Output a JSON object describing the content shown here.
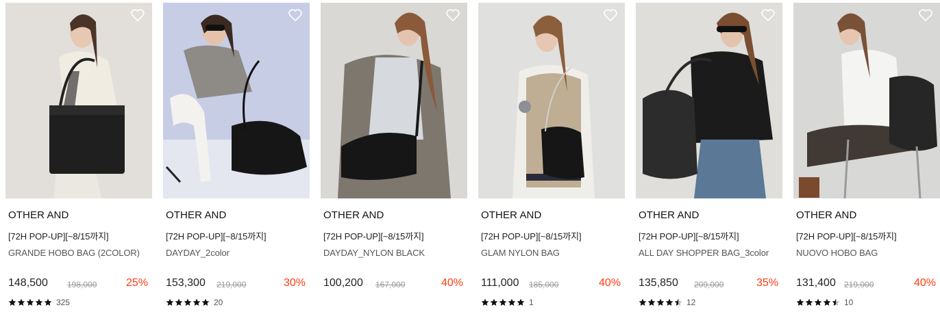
{
  "colors": {
    "discount": "#ff3a12",
    "original_price": "#999999",
    "star": "#111111"
  },
  "icons": {
    "wishlist": "heart-outline-icon",
    "rating": "star-icon"
  },
  "products": [
    {
      "brand": "OTHER AND",
      "promo": "[72H POP-UP][~8/15까지]",
      "name": "GRANDE HOBO BAG (2COLOR)",
      "price": "148,500",
      "original_price": "198,000",
      "discount": "25%",
      "stars": 5,
      "review_count": "325"
    },
    {
      "brand": "OTHER AND",
      "promo": "[72H POP-UP][~8/15까지]",
      "name": "DAYDAY_2color",
      "price": "153,300",
      "original_price": "219,000",
      "discount": "30%",
      "stars": 5,
      "review_count": "20"
    },
    {
      "brand": "OTHER AND",
      "promo": "[72H POP-UP][~8/15까지]",
      "name": "DAYDAY_NYLON BLACK",
      "price": "100,200",
      "original_price": "167,000",
      "discount": "40%",
      "stars": 0,
      "review_count": ""
    },
    {
      "brand": "OTHER AND",
      "promo": "[72H POP-UP][~8/15까지]",
      "name": "GLAM NYLON BAG",
      "price": "111,000",
      "original_price": "185,000",
      "discount": "40%",
      "stars": 5,
      "review_count": "1"
    },
    {
      "brand": "OTHER AND",
      "promo": "[72H POP-UP][~8/15까지]",
      "name": "ALL DAY SHOPPER BAG_3color",
      "price": "135,850",
      "original_price": "209,000",
      "discount": "35%",
      "stars": 4.5,
      "review_count": "12"
    },
    {
      "brand": "OTHER AND",
      "promo": "[72H POP-UP][~8/15까지]",
      "name": "NUOVO HOBO BAG",
      "price": "131,400",
      "original_price": "219,000",
      "discount": "40%",
      "stars": 4.5,
      "review_count": "10"
    }
  ]
}
